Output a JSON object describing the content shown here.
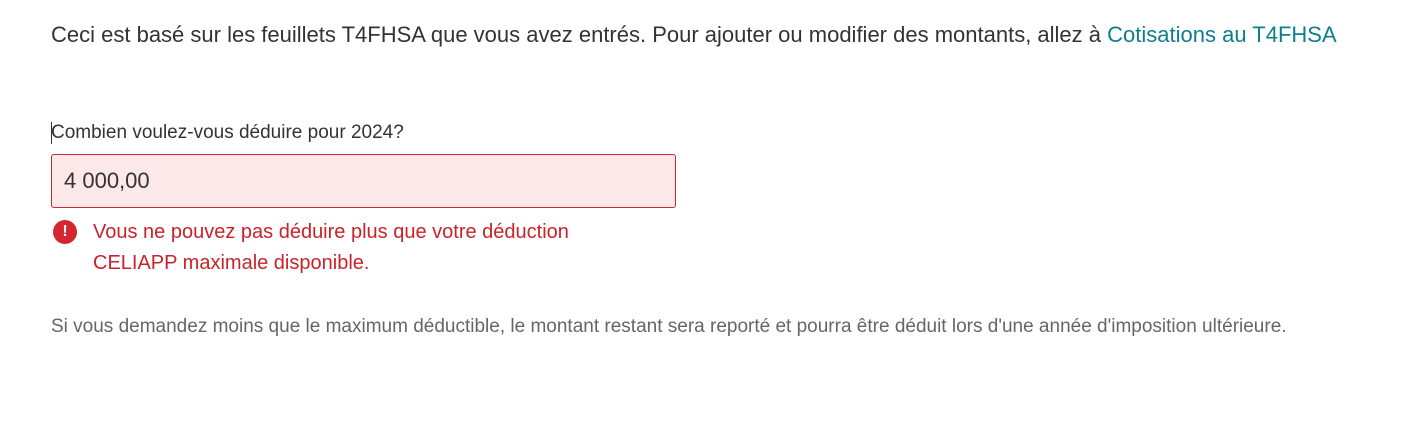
{
  "intro": {
    "text": "Ceci est basé sur les feuillets T4FHSA que vous avez entrés. Pour ajouter ou modifier des montants, allez à ",
    "link_label": "Cotisations au T4FHSA"
  },
  "deduction": {
    "question": "Combien voulez-vous déduire pour 2024?",
    "amount_value": "4 000,00",
    "error_message": "Vous ne pouvez pas déduire plus que votre déduction CELIAPP maximale disponible.",
    "error_icon": "exclamation-circle-icon",
    "error_symbol": "!"
  },
  "note": {
    "text": "Si vous demandez moins que le maximum déductible, le montant restant sera reporté et pourra être déduit lors d'une année d'imposition ultérieure."
  },
  "colors": {
    "link": "#0f7e8c",
    "error": "#d3262e",
    "error_background": "#fce8e8",
    "body_text": "#333333",
    "muted_text": "#666666"
  }
}
